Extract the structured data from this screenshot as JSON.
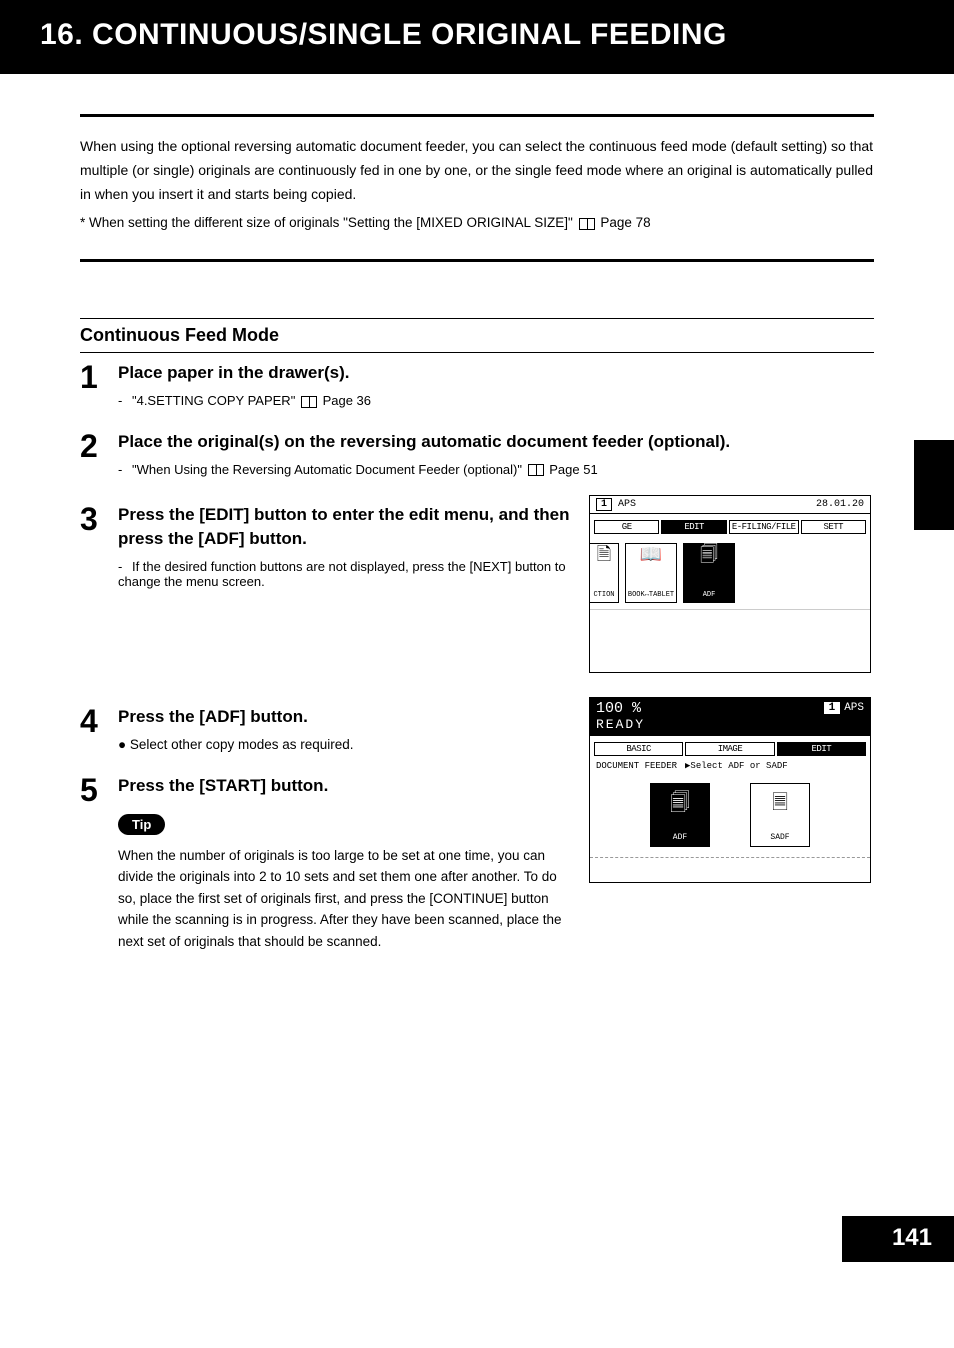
{
  "header": {
    "title": "16. CONTINUOUS/SINGLE ORIGINAL FEEDING"
  },
  "intro": {
    "para": "When using the optional reversing automatic document feeder, you can select the continuous feed mode (default setting) so that multiple (or single) originals are continuously fed in one by one, or the single feed mode where an original is automatically pulled in when you insert it and starts being copied.",
    "note_prefix": "*  When setting the different size of originals \"Setting the [MIXED ORIGINAL SIZE]\"",
    "note_page": "Page 78"
  },
  "section_title": "Continuous Feed Mode",
  "steps": {
    "s1": {
      "num": "1",
      "title": "Place paper in the drawer(s).",
      "sub_prefix": "\"4.SETTING COPY PAPER\"",
      "sub_page": "Page 36"
    },
    "s2": {
      "num": "2",
      "title": "Place the original(s) on the reversing automatic document feeder (optional).",
      "sub_prefix": "\"When Using the Reversing Automatic Document Feeder (optional)\"",
      "sub_page": "Page 51"
    },
    "s3": {
      "num": "3",
      "title": "Press the [EDIT] button to enter the edit menu, and then press the [ADF] button.",
      "sub": "If the desired function buttons are not displayed, press the [NEXT] button to change the menu screen."
    },
    "s4": {
      "num": "4",
      "title": "Press the [ADF] button.",
      "bullet": "Select other copy modes as required."
    },
    "s5": {
      "num": "5",
      "title": "Press the [START] button."
    }
  },
  "tip": {
    "label": "Tip",
    "text": "When the number of originals is too large to be set at one time, you can divide the originals into 2 to 10 sets and set them one after another. To do so, place the first set of originals first, and press the [CONTINUE] button while the scanning is in progress. After they have been scanned, place the next set of originals that should be scanned."
  },
  "lcd1": {
    "count": "1",
    "aps": "APS",
    "date": "28.01.20",
    "tabs": {
      "ge": "GE",
      "edit": "EDIT",
      "efiling": "E-FILING/FILE",
      "sett": "SETT"
    },
    "buttons": {
      "ction": "CTION",
      "book": "BOOK↔TABLET",
      "adf": "ADF"
    }
  },
  "lcd2": {
    "zoom": "100 %",
    "count": "1",
    "aps": "APS",
    "ready": "READY",
    "tabs": {
      "basic": "BASIC",
      "image": "IMAGE",
      "edit": "EDIT"
    },
    "subline_a": "DOCUMENT FEEDER",
    "subline_b": "▶Select ADF or SADF",
    "btn_adf": "ADF",
    "btn_sadf": "SADF"
  },
  "page_number": "141"
}
